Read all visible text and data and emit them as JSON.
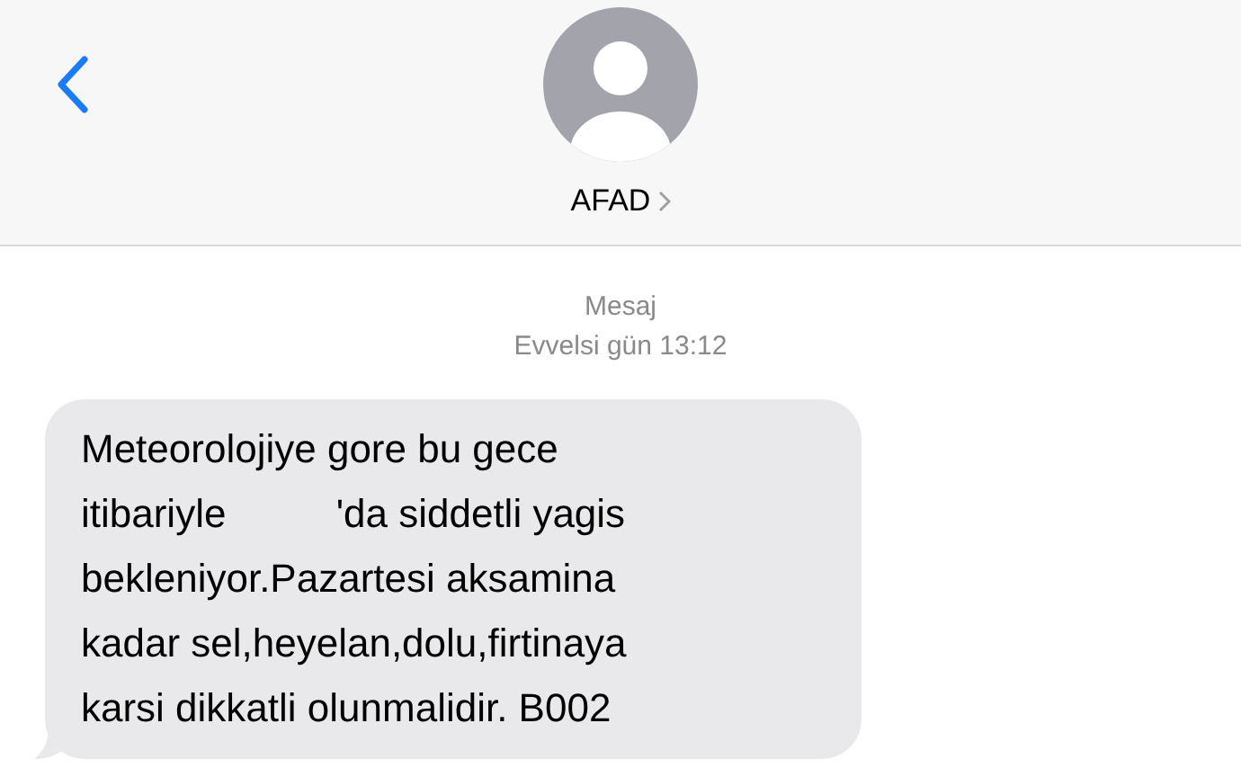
{
  "header": {
    "contact": "AFAD"
  },
  "timestamp": {
    "label": "Mesaj",
    "time": "Evvelsi gün 13:12"
  },
  "messages": [
    {
      "text": "Meteorolojiye gore bu gece\nitibariyle          'da siddetli yagis\nbekleniyor.Pazartesi aksamina\nkadar sel,heyelan,dolu,firtinaya\nkarsi dikkatli olunmalidir. B002"
    }
  ]
}
